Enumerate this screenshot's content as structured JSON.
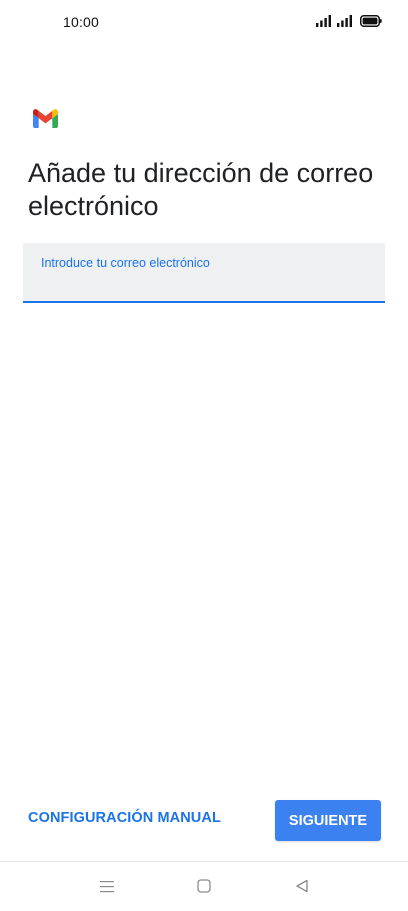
{
  "status_bar": {
    "time": "10:00",
    "icons": [
      "signal-icon",
      "signal-icon",
      "battery-icon"
    ]
  },
  "app": {
    "logo": "gmail-logo-icon",
    "colors": {
      "accent": "#1a73e8",
      "button": "#3b82f0",
      "field_bg": "#eef0f2",
      "title_text": "#202124"
    }
  },
  "page": {
    "title": "Añade tu dirección de correo electrónico"
  },
  "email_field": {
    "label": "Introduce tu correo electrónico",
    "value": "",
    "placeholder": ""
  },
  "actions": {
    "manual_label": "CONFIGURACIÓN MANUAL",
    "next_label": "SIGUIENTE"
  },
  "nav_bar": {
    "icons": [
      "menu-icon",
      "home-icon",
      "back-icon"
    ]
  }
}
